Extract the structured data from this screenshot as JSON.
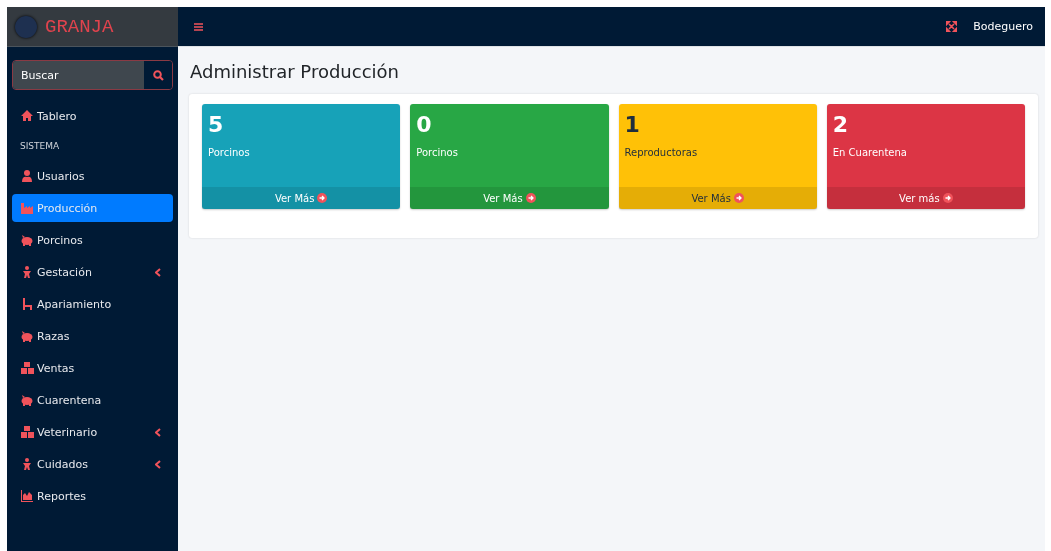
{
  "brand": {
    "title": "GRANJA"
  },
  "search": {
    "placeholder": "Buscar"
  },
  "sidebar": {
    "items": [
      {
        "kind": "link",
        "label": "Tablero",
        "selected": false,
        "submenu": false
      },
      {
        "kind": "header",
        "label": "SISTEMA"
      },
      {
        "kind": "link",
        "label": "Usuarios",
        "selected": false,
        "submenu": false
      },
      {
        "kind": "link",
        "label": "Producción",
        "selected": true,
        "submenu": false
      },
      {
        "kind": "link",
        "label": "Porcinos",
        "selected": false,
        "submenu": false
      },
      {
        "kind": "link",
        "label": "Gestación",
        "selected": false,
        "submenu": true
      },
      {
        "kind": "link",
        "label": "Apariamiento",
        "selected": false,
        "submenu": false
      },
      {
        "kind": "link",
        "label": "Razas",
        "selected": false,
        "submenu": false
      },
      {
        "kind": "link",
        "label": "Ventas",
        "selected": false,
        "submenu": false
      },
      {
        "kind": "link",
        "label": "Cuarentena",
        "selected": false,
        "submenu": false
      },
      {
        "kind": "link",
        "label": "Veterinario",
        "selected": false,
        "submenu": true
      },
      {
        "kind": "link",
        "label": "Cuidados",
        "selected": false,
        "submenu": true
      },
      {
        "kind": "link",
        "label": "Reportes",
        "selected": false,
        "submenu": false
      }
    ]
  },
  "topbar": {
    "user": "Bodeguero"
  },
  "page": {
    "title": "Administrar Producción"
  },
  "cards": [
    {
      "value": "5",
      "label": "Porcinos",
      "link": "Ver Más",
      "color": "#17a2b8"
    },
    {
      "value": "0",
      "label": "Porcinos",
      "link": "Ver Más",
      "color": "#28a745"
    },
    {
      "value": "1",
      "label": "Reproductoras",
      "link": "Ver Más",
      "color": "#ffc107"
    },
    {
      "value": "2",
      "label": "En Cuarentena",
      "link": "Ver más",
      "color": "#dc3545"
    }
  ]
}
